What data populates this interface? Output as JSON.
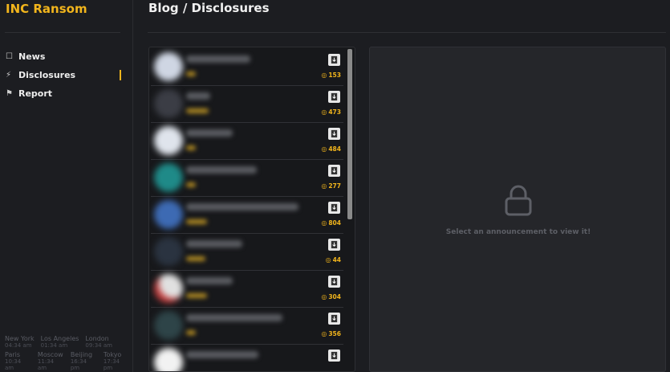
{
  "app": {
    "name": "INC Ransom"
  },
  "nav": {
    "items": [
      {
        "label": "News",
        "icon": "bookmark-icon"
      },
      {
        "label": "Disclosures",
        "icon": "bolt-icon",
        "active": true
      },
      {
        "label": "Report",
        "icon": "flag-icon"
      }
    ]
  },
  "clocks": [
    {
      "city": "New York",
      "time": "04:34 am"
    },
    {
      "city": "Los Angeles",
      "time": "01:34 am"
    },
    {
      "city": "London",
      "time": "09:34 am"
    },
    {
      "city": "Paris",
      "time": "10:34 am"
    },
    {
      "city": "Moscow",
      "time": "11:34 am"
    },
    {
      "city": "Beijing",
      "time": "16:34 pm"
    },
    {
      "city": "Tokyo",
      "time": "17:34 pm"
    }
  ],
  "page": {
    "title": "Blog / Disclosures"
  },
  "disclosures": [
    {
      "views": "153"
    },
    {
      "views": "473"
    },
    {
      "views": "484"
    },
    {
      "views": "277"
    },
    {
      "views": "804"
    },
    {
      "views": "44"
    },
    {
      "views": "304"
    },
    {
      "views": "356"
    },
    {
      "views": ""
    }
  ],
  "viewer": {
    "message": "Select an announcement to view it!"
  },
  "colors": {
    "accent": "#f2b51c",
    "background": "#1c1d21",
    "panel": "#25262a"
  }
}
